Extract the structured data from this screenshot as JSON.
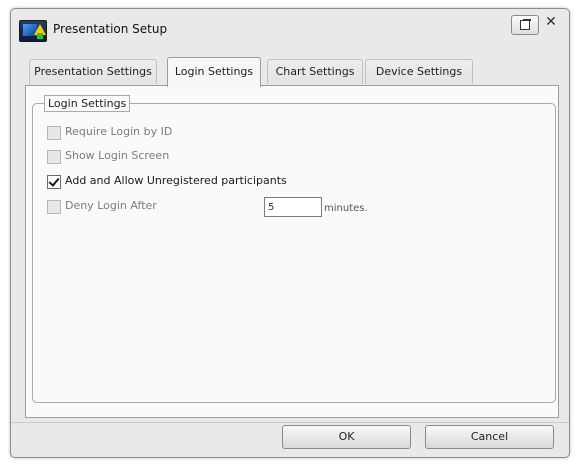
{
  "window": {
    "title": "Presentation Setup",
    "app_icon": "presentation-app-icon",
    "restore_icon": "restore-window-icon",
    "close_glyph": "✕"
  },
  "tabs": [
    {
      "label": "Presentation Settings",
      "active": false
    },
    {
      "label": "Login Settings",
      "active": true
    },
    {
      "label": "Chart Settings",
      "active": false
    },
    {
      "label": "Device Settings",
      "active": false
    }
  ],
  "login_settings": {
    "group_title": "Login Settings",
    "options": [
      {
        "label": "Require Login by ID",
        "checked": false,
        "enabled": false
      },
      {
        "label": "Show Login Screen",
        "checked": false,
        "enabled": false
      },
      {
        "label": "Add and Allow Unregistered participants",
        "checked": true,
        "enabled": true
      },
      {
        "label": "Deny Login After",
        "checked": false,
        "enabled": false
      }
    ],
    "deny_minutes_value": "5",
    "minutes_label": "minutes."
  },
  "buttons": {
    "ok": "OK",
    "cancel": "Cancel"
  }
}
